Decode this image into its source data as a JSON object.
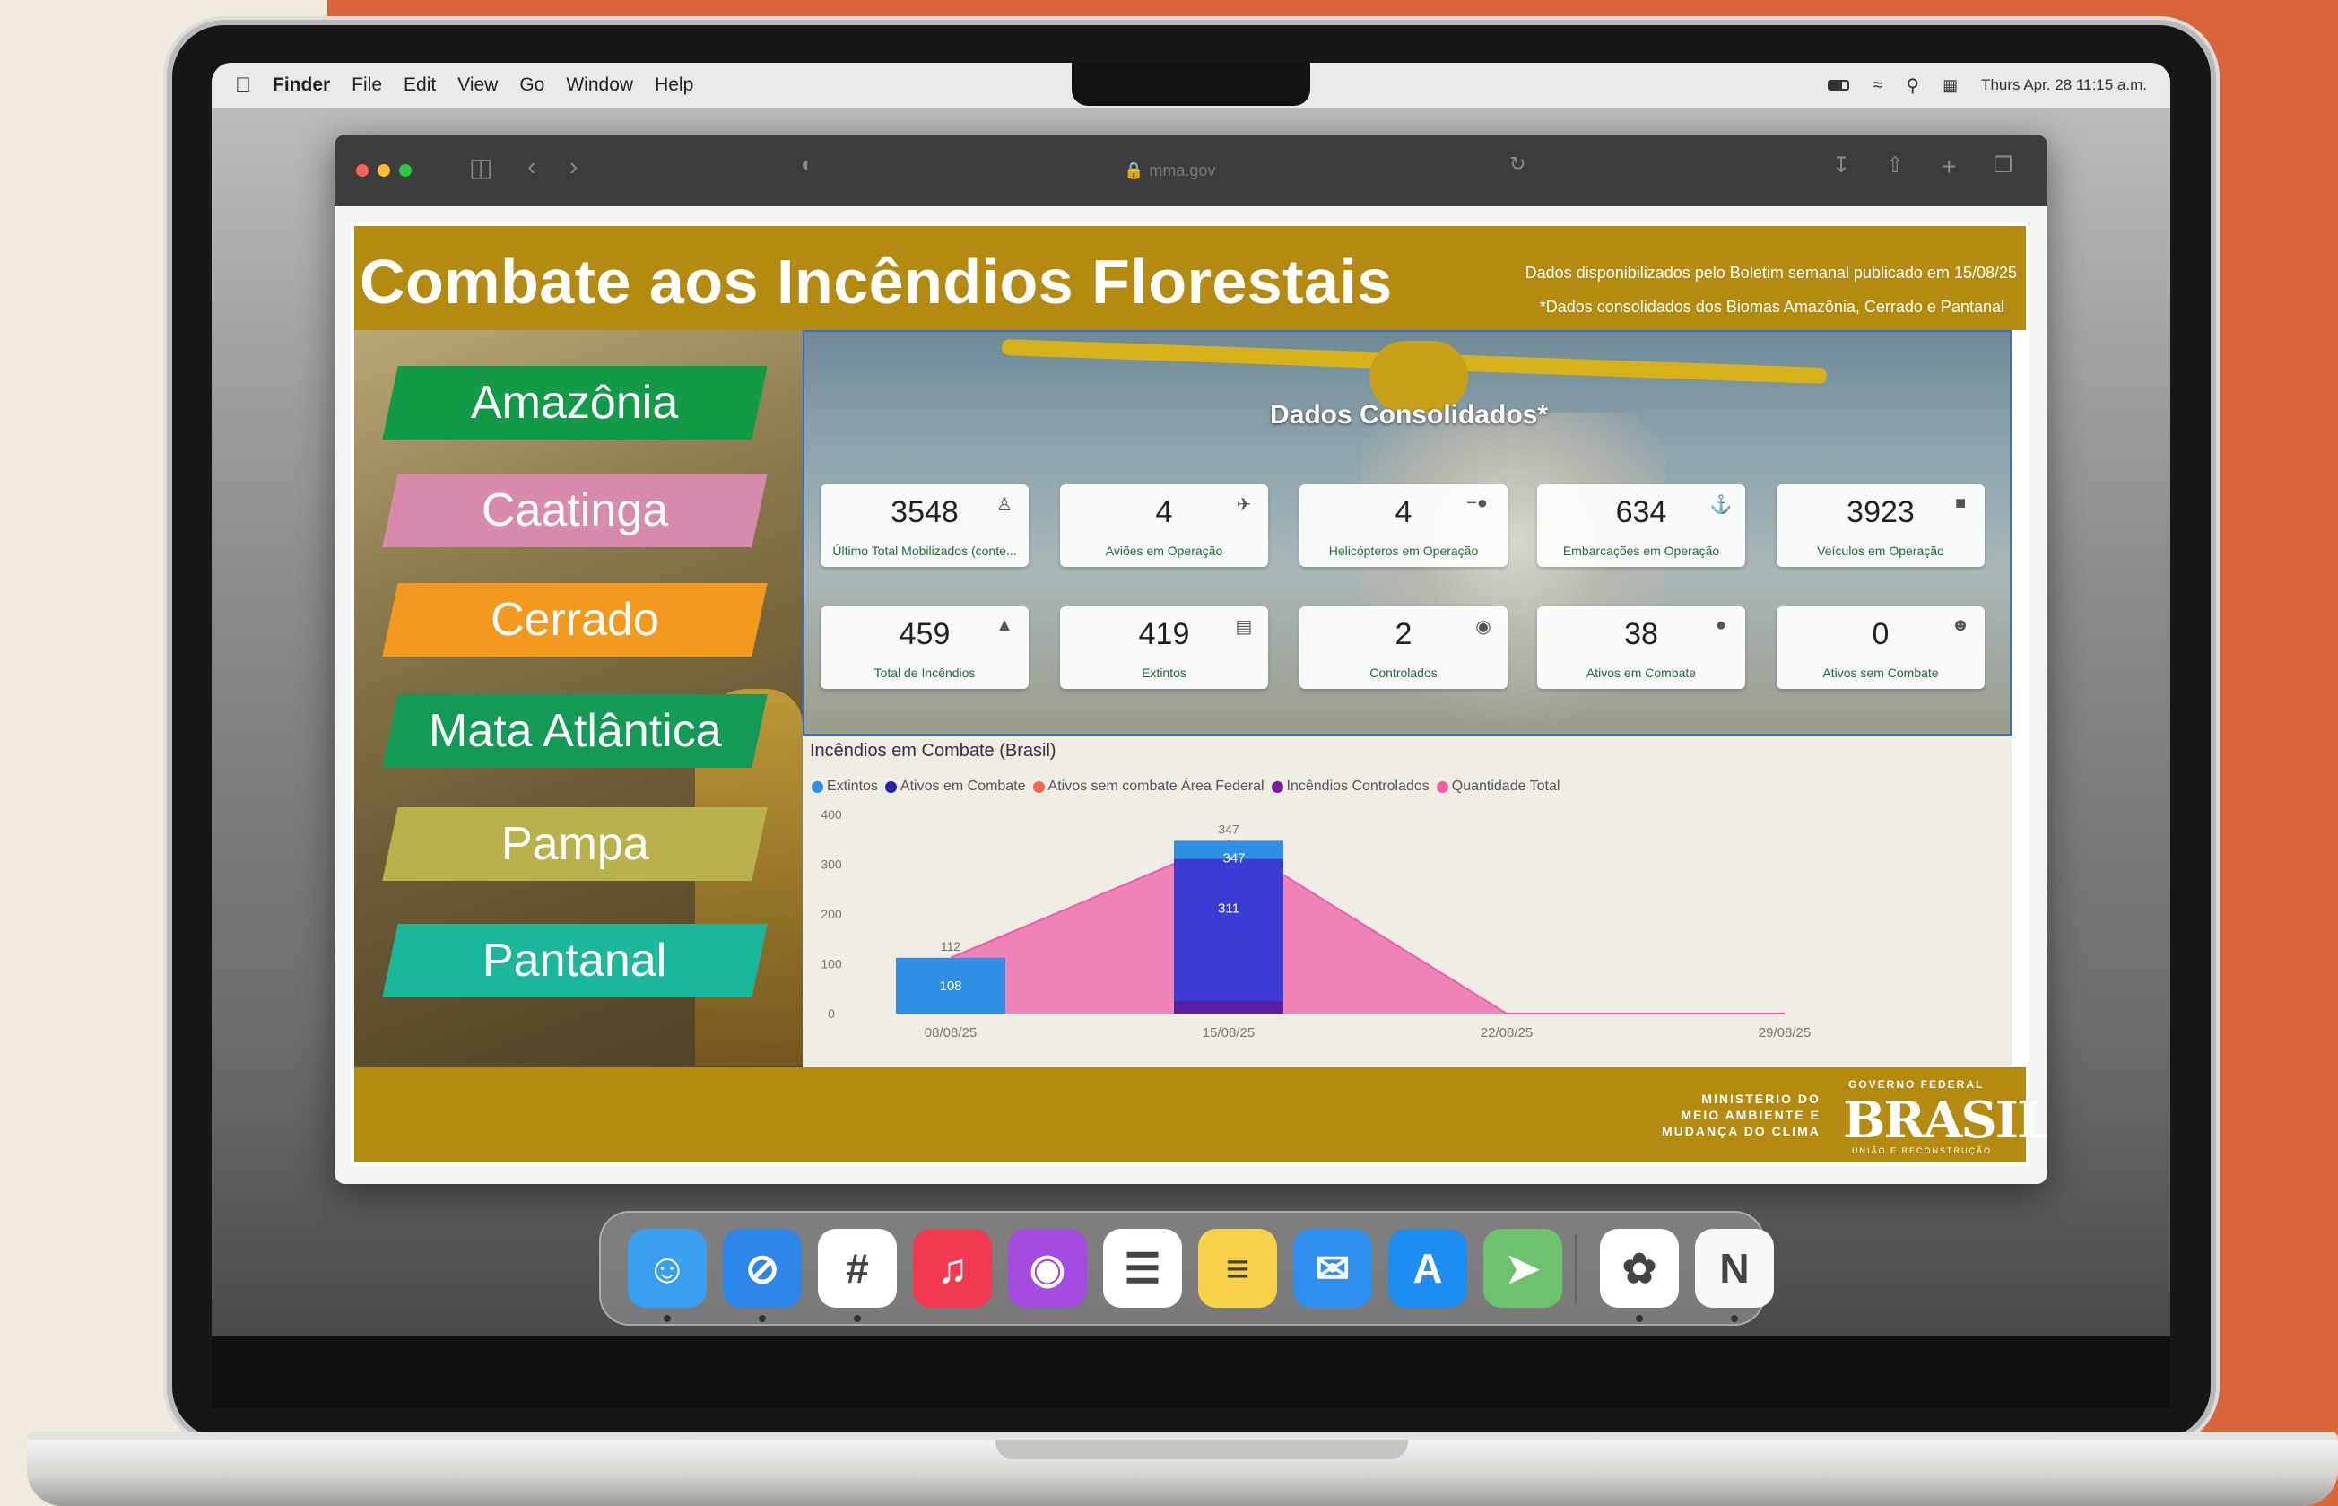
{
  "menubar": {
    "app": "Finder",
    "items": [
      "File",
      "Edit",
      "View",
      "Go",
      "Window",
      "Help"
    ],
    "clock": "Thurs Apr. 28 11:15 a.m."
  },
  "browser": {
    "url": "mma.gov"
  },
  "dashboard": {
    "title": "Combate aos Incêndios Florestais",
    "note1": "Dados disponibilizados pelo Boletim semanal publicado em 15/08/25",
    "note2": "*Dados consolidados dos Biomas Amazônia, Cerrado e Pantanal",
    "section_title": "Dados Consolidados*",
    "biomes": [
      {
        "label": "Amazônia",
        "color": "#139a47"
      },
      {
        "label": "Caatinga",
        "color": "#d88aac"
      },
      {
        "label": "Cerrado",
        "color": "#f39a1e"
      },
      {
        "label": "Mata Atlântica",
        "color": "#139a57"
      },
      {
        "label": "Pampa",
        "color": "#b9b24c"
      },
      {
        "label": "Pantanal",
        "color": "#1bb79b"
      }
    ],
    "cards": [
      {
        "value": "3548",
        "label": "Último Total Mobilizados (conte...",
        "icon": "people-icon"
      },
      {
        "value": "4",
        "label": "Aviões em Operação",
        "icon": "plane-icon"
      },
      {
        "value": "4",
        "label": "Helicópteros em Operação",
        "icon": "helicopter-icon"
      },
      {
        "value": "634",
        "label": "Embarcações em Operação",
        "icon": "boat-icon"
      },
      {
        "value": "3923",
        "label": "Veículos em Operação",
        "icon": "truck-icon"
      },
      {
        "value": "459",
        "label": "Total de Incêndios",
        "icon": "fire-icon"
      },
      {
        "value": "419",
        "label": "Extintos",
        "icon": "extinguished-icon"
      },
      {
        "value": "2",
        "label": "Controlados",
        "icon": "controlled-icon"
      },
      {
        "value": "38",
        "label": "Ativos em Combate",
        "icon": "active-icon"
      },
      {
        "value": "0",
        "label": "Ativos sem Combate",
        "icon": "inactive-icon"
      }
    ],
    "footer": {
      "ministry": "MINISTÉRIO DO\nMEIO AMBIENTE E\nMUDANÇA DO CLIMA",
      "gov_top": "GOVERNO FEDERAL",
      "gov_name": "BRASIL",
      "gov_sub": "UNIÃO E RECONSTRUÇÃO"
    }
  },
  "chart_data": {
    "type": "bar",
    "title": "Incêndios em Combate (Brasil)",
    "legend": [
      "Extintos",
      "Ativos em Combate",
      "Ativos sem combate Área Federal",
      "Incêndios Controlados",
      "Quantidade Total"
    ],
    "legend_colors": [
      "#2f8ee5",
      "#2222aa",
      "#ef6a4a",
      "#7a1c9c",
      "#ef5fa8"
    ],
    "categories": [
      "08/08/25",
      "15/08/25",
      "22/08/25",
      "29/08/25"
    ],
    "y_ticks": [
      0,
      100,
      200,
      300,
      400
    ],
    "ylim": [
      0,
      400
    ],
    "series": [
      {
        "name": "Extintos",
        "values": [
          108,
          311,
          0,
          0
        ]
      },
      {
        "name": "Ativos em Combate",
        "values": [
          4,
          36,
          0,
          0
        ]
      },
      {
        "name": "Incêndios Controlados",
        "values": [
          0,
          0,
          0,
          0
        ]
      },
      {
        "name": "Quantidade Total",
        "values": [
          112,
          347,
          0,
          0
        ]
      }
    ],
    "bar_labels": [
      {
        "category": "08/08/25",
        "extintos": "108",
        "total": "112"
      },
      {
        "category": "15/08/25",
        "extintos": "311",
        "ativos": "347",
        "total": "347"
      }
    ]
  },
  "dock": {
    "apps": [
      {
        "name": "Finder",
        "glyph": "☺",
        "color": "#3b9ff0"
      },
      {
        "name": "Safari",
        "glyph": "⊘",
        "color": "#2d86e8"
      },
      {
        "name": "Slack",
        "glyph": "#",
        "color": "#ffffff"
      },
      {
        "name": "Music",
        "glyph": "♫",
        "color": "#f23a52"
      },
      {
        "name": "Podcasts",
        "glyph": "◉",
        "color": "#a64be0"
      },
      {
        "name": "Reminders",
        "glyph": "☰",
        "color": "#ffffff"
      },
      {
        "name": "Notes",
        "glyph": "≡",
        "color": "#f7d24a"
      },
      {
        "name": "Mail",
        "glyph": "✉",
        "color": "#2f8ff0"
      },
      {
        "name": "App Store",
        "glyph": "A",
        "color": "#1d8ef0"
      },
      {
        "name": "Maps",
        "glyph": "➤",
        "color": "#6cc26d"
      },
      {
        "name": "Photos",
        "glyph": "✿",
        "color": "#ffffff"
      },
      {
        "name": "News",
        "glyph": "N",
        "color": "#f8f8f8"
      }
    ]
  }
}
